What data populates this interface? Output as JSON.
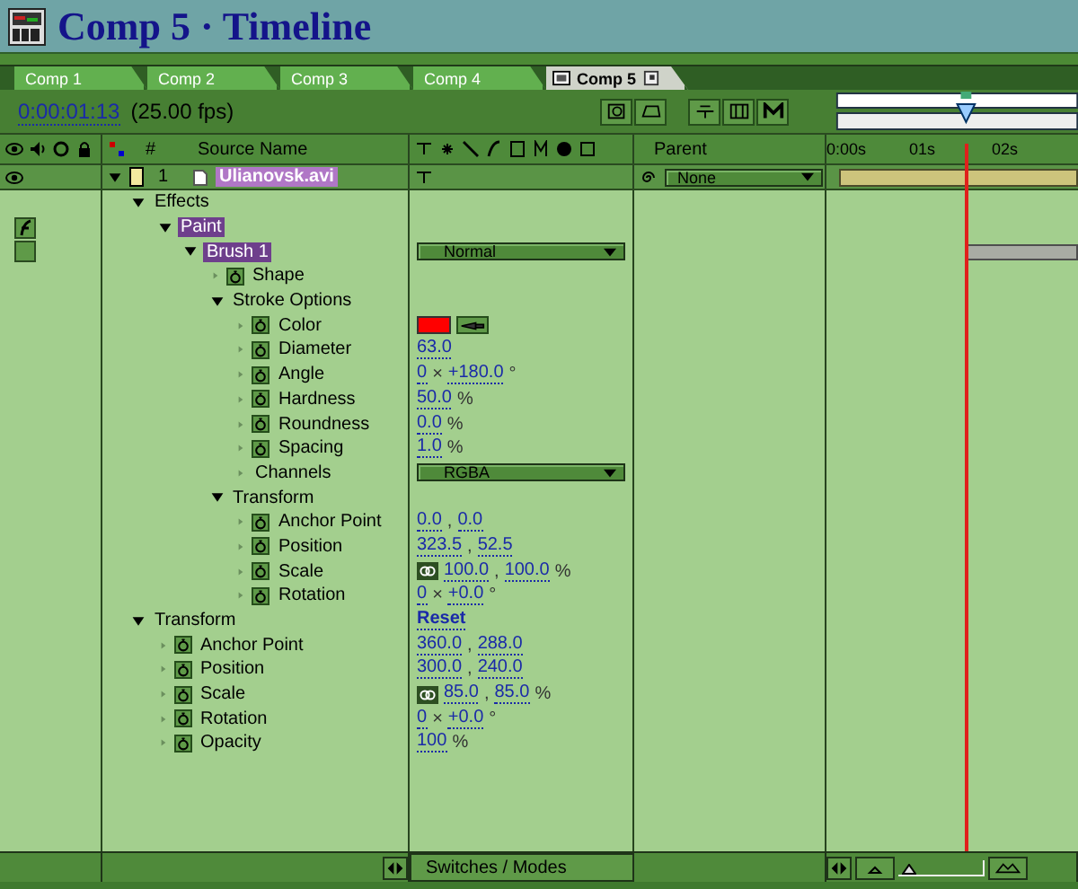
{
  "window": {
    "title": "Comp 5 · Timeline"
  },
  "tabs": [
    {
      "label": "Comp 1",
      "selected": false
    },
    {
      "label": "Comp 2",
      "selected": false
    },
    {
      "label": "Comp 3",
      "selected": false
    },
    {
      "label": "Comp 4",
      "selected": false
    },
    {
      "label": "Comp 5",
      "selected": true
    }
  ],
  "time": {
    "current": "0:00:01:13",
    "fps": "(25.00 fps)"
  },
  "columns": {
    "number": "#",
    "source_name": "Source Name",
    "parent": "Parent",
    "ruler": [
      "0:00s",
      "01s",
      "02s"
    ]
  },
  "layer": {
    "number": "1",
    "name": "Ulianovsk.avi",
    "selected": true,
    "expanded": true,
    "parent": "None",
    "children": [
      {
        "label": "Effects",
        "expanded": true,
        "selected": false,
        "children": [
          {
            "label": "Paint",
            "expanded": true,
            "selected": true,
            "fx_on": true,
            "children": [
              {
                "label": "Brush 1",
                "expanded": true,
                "selected": true,
                "fx_on": false,
                "bar": true,
                "value": {
                  "kind": "dropdown",
                  "text": "Normal"
                },
                "children": [
                  {
                    "label": "Shape",
                    "expanded": false,
                    "selected": false,
                    "stopwatch": true
                  },
                  {
                    "label": "Stroke Options",
                    "expanded": true,
                    "selected": false,
                    "children": [
                      {
                        "label": "Color",
                        "expanded": false,
                        "selected": false,
                        "stopwatch": true,
                        "value": {
                          "kind": "color",
                          "color": "#ff0000"
                        }
                      },
                      {
                        "label": "Diameter",
                        "expanded": false,
                        "selected": false,
                        "stopwatch": true,
                        "value": {
                          "kind": "numbers",
                          "items": [
                            "63.0"
                          ]
                        }
                      },
                      {
                        "label": "Angle",
                        "expanded": false,
                        "selected": false,
                        "stopwatch": true,
                        "value": {
                          "kind": "numbers",
                          "items": [
                            "0",
                            "+180.0"
                          ],
                          "separator": "×",
                          "unit": "°"
                        }
                      },
                      {
                        "label": "Hardness",
                        "expanded": false,
                        "selected": false,
                        "stopwatch": true,
                        "value": {
                          "kind": "numbers",
                          "items": [
                            "50.0"
                          ],
                          "unit": "%"
                        }
                      },
                      {
                        "label": "Roundness",
                        "expanded": false,
                        "selected": false,
                        "stopwatch": true,
                        "value": {
                          "kind": "numbers",
                          "items": [
                            "0.0"
                          ],
                          "unit": "%"
                        }
                      },
                      {
                        "label": "Spacing",
                        "expanded": false,
                        "selected": false,
                        "stopwatch": true,
                        "value": {
                          "kind": "numbers",
                          "items": [
                            "1.0"
                          ],
                          "unit": "%"
                        }
                      },
                      {
                        "label": "Channels",
                        "expanded": false,
                        "selected": false,
                        "stopwatch": false,
                        "value": {
                          "kind": "dropdown",
                          "text": "RGBA"
                        }
                      }
                    ]
                  },
                  {
                    "label": "Transform",
                    "expanded": true,
                    "selected": false,
                    "children": [
                      {
                        "label": "Anchor Point",
                        "expanded": false,
                        "selected": false,
                        "stopwatch": true,
                        "value": {
                          "kind": "numbers",
                          "items": [
                            "0.0",
                            "0.0"
                          ],
                          "separator": ","
                        }
                      },
                      {
                        "label": "Position",
                        "expanded": false,
                        "selected": false,
                        "stopwatch": true,
                        "value": {
                          "kind": "numbers",
                          "items": [
                            "323.5",
                            "52.5"
                          ],
                          "separator": ","
                        }
                      },
                      {
                        "label": "Scale",
                        "expanded": false,
                        "selected": false,
                        "stopwatch": true,
                        "value": {
                          "kind": "numbers",
                          "linked": true,
                          "items": [
                            "100.0",
                            "100.0"
                          ],
                          "separator": ",",
                          "unit": "%"
                        }
                      },
                      {
                        "label": "Rotation",
                        "expanded": false,
                        "selected": false,
                        "stopwatch": true,
                        "value": {
                          "kind": "numbers",
                          "items": [
                            "0",
                            "+0.0"
                          ],
                          "separator": "×",
                          "unit": "°"
                        }
                      }
                    ]
                  }
                ]
              }
            ]
          }
        ]
      },
      {
        "label": "Transform",
        "expanded": true,
        "selected": false,
        "value": {
          "kind": "link",
          "text": "Reset"
        },
        "children": [
          {
            "label": "Anchor Point",
            "expanded": false,
            "selected": false,
            "stopwatch": true,
            "value": {
              "kind": "numbers",
              "items": [
                "360.0",
                "288.0"
              ],
              "separator": ","
            }
          },
          {
            "label": "Position",
            "expanded": false,
            "selected": false,
            "stopwatch": true,
            "value": {
              "kind": "numbers",
              "items": [
                "300.0",
                "240.0"
              ],
              "separator": ","
            }
          },
          {
            "label": "Scale",
            "expanded": false,
            "selected": false,
            "stopwatch": true,
            "value": {
              "kind": "numbers",
              "linked": true,
              "items": [
                "85.0",
                "85.0"
              ],
              "separator": ",",
              "unit": "%"
            }
          },
          {
            "label": "Rotation",
            "expanded": false,
            "selected": false,
            "stopwatch": true,
            "value": {
              "kind": "numbers",
              "items": [
                "0",
                "+0.0"
              ],
              "separator": "×",
              "unit": "°"
            }
          },
          {
            "label": "Opacity",
            "expanded": false,
            "selected": false,
            "stopwatch": true,
            "value": {
              "kind": "numbers",
              "items": [
                "100"
              ],
              "unit": "%"
            }
          }
        ]
      }
    ]
  },
  "bottom_bar": {
    "toggle": "Switches / Modes",
    "zoom": {
      "level": 0.05
    }
  }
}
